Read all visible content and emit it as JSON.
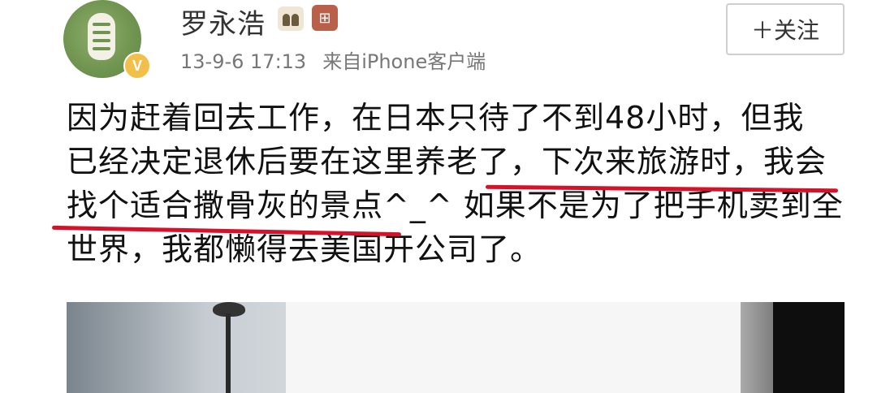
{
  "user": {
    "name": "罗永浩",
    "verified_badge": "V",
    "badge_icons": [
      "fans-badge-icon",
      "member-badge-icon"
    ]
  },
  "meta": {
    "time": "13-9-6 17:13",
    "source": "来自iPhone客户端"
  },
  "follow": {
    "label": "＋关注"
  },
  "post": {
    "line1": "因为赶着回去工作，在日本只待了不到48小时，但我",
    "line2_a": "已经决定退休后要在这里养老了，",
    "line2_b": "下次来旅游时，我会",
    "line3_a": "找个适合撒骨灰的景点^_^",
    "line3_b": " 如果不是为了把手机卖到全",
    "line4": "世界，我都懒得去美国开公司了。"
  },
  "colors": {
    "underline": "#d4122a",
    "text": "#111111",
    "meta": "#777777",
    "avatar_green": "#6f9450",
    "verified_yellow": "#f2c04a"
  }
}
